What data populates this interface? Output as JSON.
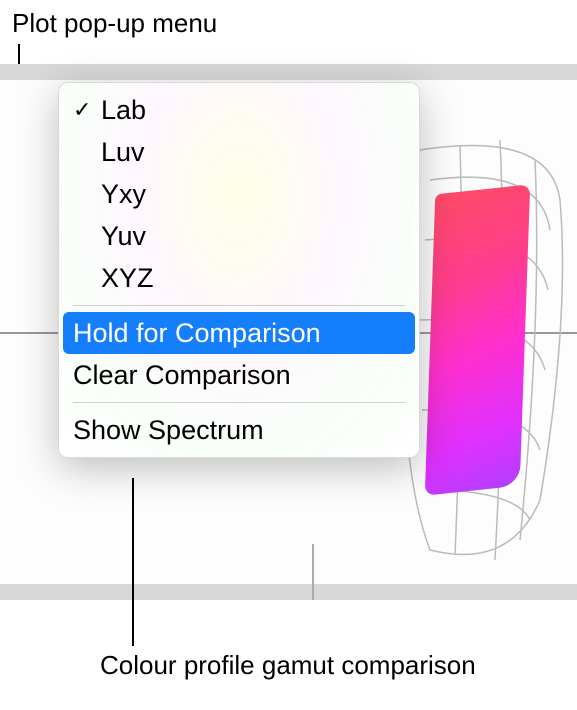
{
  "annotations": {
    "top": "Plot pop-up menu",
    "bottom": "Colour profile gamut comparison"
  },
  "menu": {
    "items": [
      {
        "label": "Lab",
        "checked": true
      },
      {
        "label": "Luv",
        "checked": false
      },
      {
        "label": "Yxy",
        "checked": false
      },
      {
        "label": "Yuv",
        "checked": false
      },
      {
        "label": "XYZ",
        "checked": false
      }
    ],
    "highlighted": "Hold for Comparison",
    "clear": "Clear Comparison",
    "spectrum": "Show Spectrum"
  }
}
